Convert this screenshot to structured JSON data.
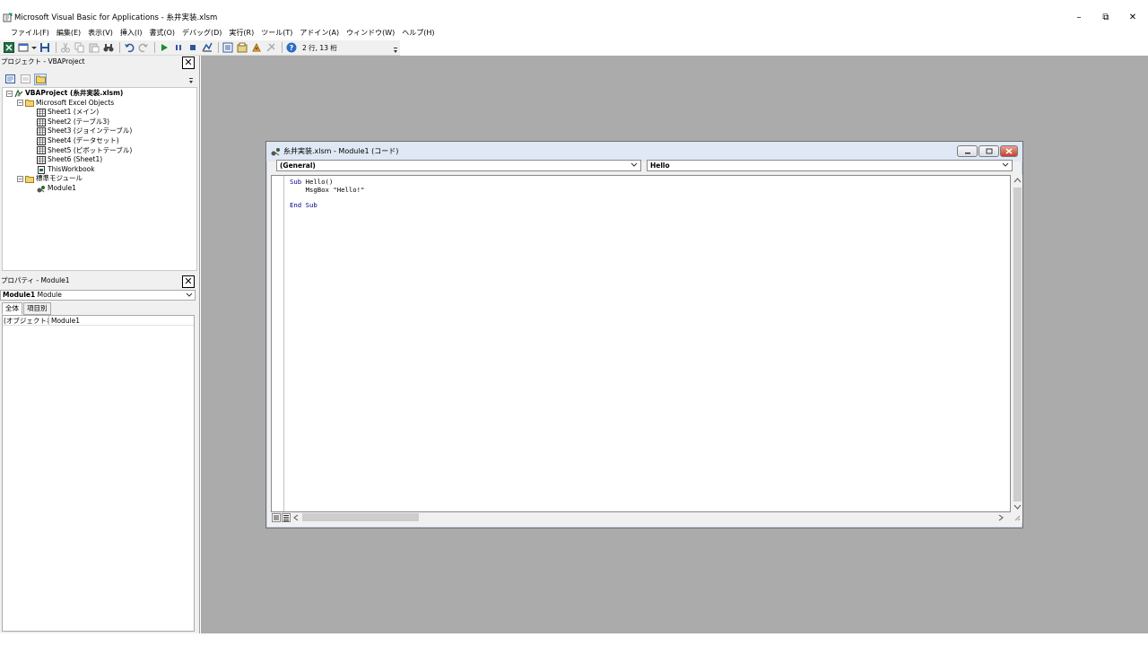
{
  "window": {
    "title": "Microsoft Visual Basic for Applications - 糸井実装.xlsm",
    "minimize": "–",
    "restore": "⧉",
    "close": "✕"
  },
  "menu": [
    "ファイル(F)",
    "編集(E)",
    "表示(V)",
    "挿入(I)",
    "書式(O)",
    "デバッグ(D)",
    "実行(R)",
    "ツール(T)",
    "アドイン(A)",
    "ウィンドウ(W)",
    "ヘルプ(H)"
  ],
  "toolbar": {
    "cursor_position": "2 行, 13 桁"
  },
  "project_panel": {
    "title": "プロジェクト - VBAProject",
    "close": "✕",
    "tree": [
      {
        "label": "VBAProject (糸井実装.xlsm)",
        "level": 0,
        "bold": true,
        "expander": "−",
        "icon": "vba-project-icon"
      },
      {
        "label": "Microsoft Excel Objects",
        "level": 1,
        "bold": false,
        "expander": "−",
        "icon": "folder-icon"
      },
      {
        "label": "Sheet1 (メイン)",
        "level": 2,
        "bold": false,
        "icon": "sheet-icon"
      },
      {
        "label": "Sheet2 (テーブル3)",
        "level": 2,
        "bold": false,
        "icon": "sheet-icon"
      },
      {
        "label": "Sheet3 (ジョインテーブル)",
        "level": 2,
        "bold": false,
        "icon": "sheet-icon"
      },
      {
        "label": "Sheet4 (データセット)",
        "level": 2,
        "bold": false,
        "icon": "sheet-icon"
      },
      {
        "label": "Sheet5 (ピボットテーブル)",
        "level": 2,
        "bold": false,
        "icon": "sheet-icon"
      },
      {
        "label": "Sheet6 (Sheet1)",
        "level": 2,
        "bold": false,
        "icon": "sheet-icon"
      },
      {
        "label": "ThisWorkbook",
        "level": 2,
        "bold": false,
        "icon": "workbook-icon"
      },
      {
        "label": "標準モジュール",
        "level": 1,
        "bold": false,
        "expander": "−",
        "icon": "folder-icon"
      },
      {
        "label": "Module1",
        "level": 2,
        "bold": false,
        "icon": "module-icon"
      }
    ]
  },
  "properties_panel": {
    "title": "プロパティ - Module1",
    "close": "✕",
    "object_name": "Module1",
    "object_type": "Module",
    "tabs": [
      "全体",
      "項目別"
    ],
    "rows": [
      {
        "key": "(オブジェクト名)",
        "value": "Module1"
      }
    ]
  },
  "code_window": {
    "title": "糸井実装.xlsm - Module1 (コード)",
    "object_combo": "(General)",
    "procedure_combo": "Hello",
    "code_lines": [
      {
        "kw": "Sub",
        "rest": " Hello()"
      },
      {
        "kw": "",
        "rest": "    MsgBox \"Hello!\""
      },
      {
        "kw": "",
        "rest": ""
      },
      {
        "kw": "End Sub",
        "rest": ""
      }
    ]
  }
}
